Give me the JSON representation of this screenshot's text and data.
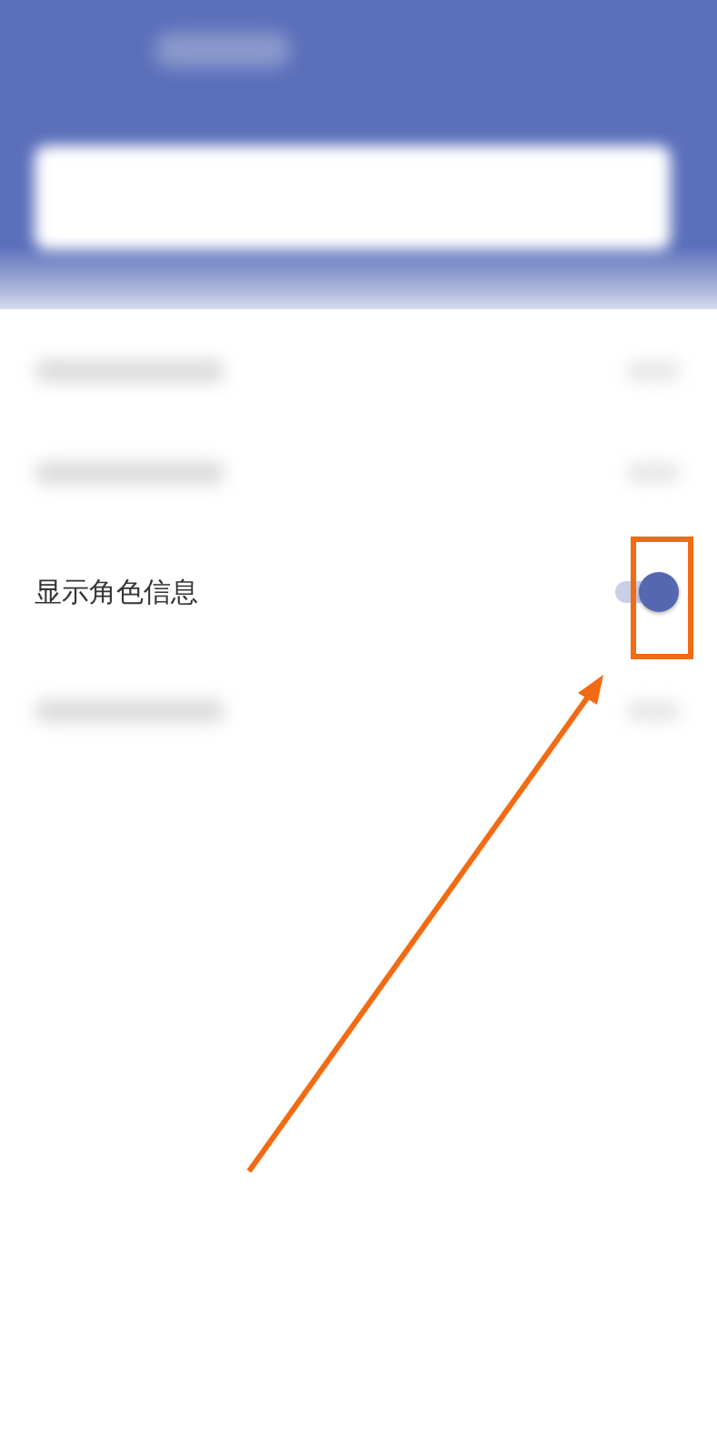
{
  "header": {
    "kind": "blurred"
  },
  "rows": [
    {
      "kind": "blurred"
    },
    {
      "kind": "blurred"
    },
    {
      "kind": "toggle",
      "label": "显示角色信息",
      "on": true
    },
    {
      "kind": "blurred"
    }
  ],
  "annotations": {
    "highlight_box": true,
    "arrow": true
  }
}
